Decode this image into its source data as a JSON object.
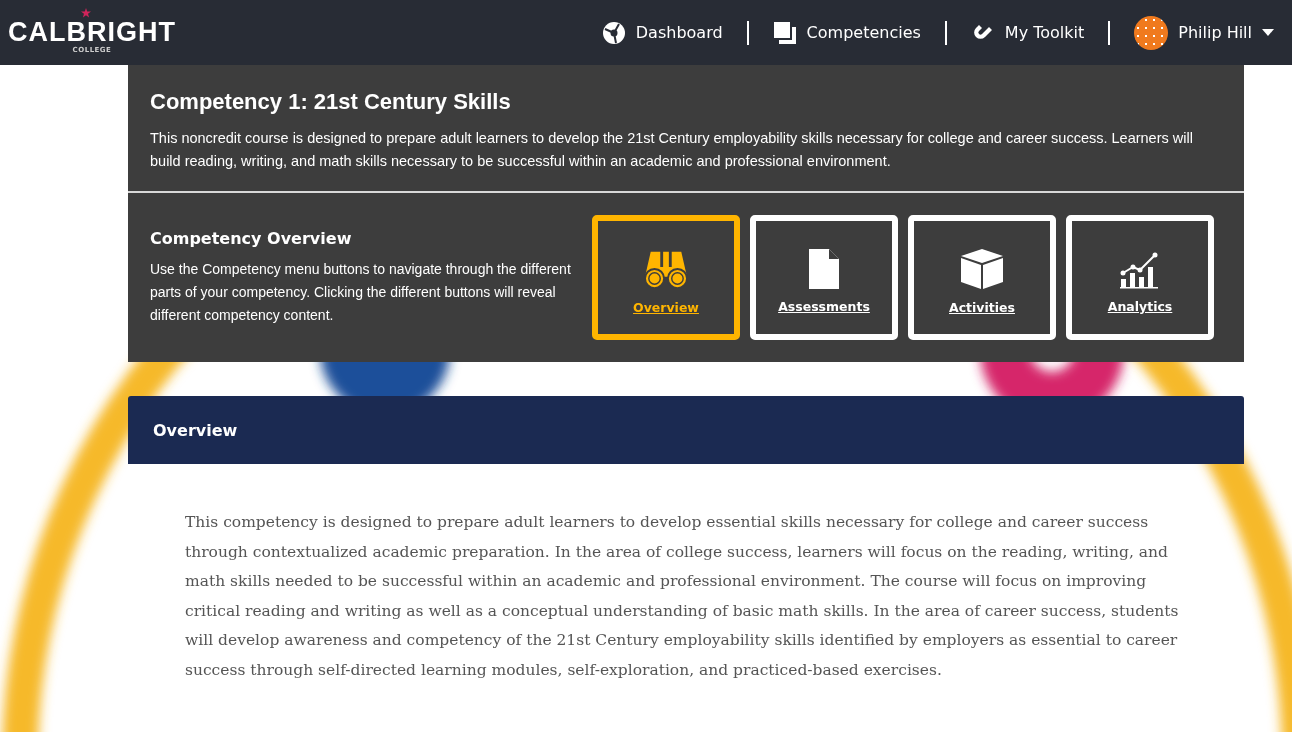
{
  "header": {
    "logo": {
      "word": "CALBRIGHT",
      "sub": "COLLEGE"
    },
    "nav": [
      {
        "label": "Dashboard",
        "kind": "dashboard"
      },
      {
        "label": "Competencies",
        "kind": "competencies"
      },
      {
        "label": "My Toolkit",
        "kind": "toolkit"
      }
    ],
    "user": {
      "name": "Philip Hill"
    }
  },
  "competency": {
    "title": "Competency 1: 21st Century Skills",
    "description": "This noncredit course is designed to prepare adult learners to develop the 21st Century employability skills necessary for college and career success. Learners will build reading, writing, and math skills necessary to be successful within an academic and professional environment."
  },
  "overview_panel": {
    "heading": "Competency Overview",
    "text": "Use the Competency menu buttons to navigate through the different parts of your competency. Clicking the different buttons will reveal different competency content.",
    "buttons": [
      {
        "label": "Overview",
        "kind": "binoculars",
        "selected": true
      },
      {
        "label": "Assessments",
        "kind": "document",
        "selected": false
      },
      {
        "label": "Activities",
        "kind": "cube",
        "selected": false
      },
      {
        "label": "Analytics",
        "kind": "chart",
        "selected": false
      }
    ]
  },
  "section": {
    "title": "Overview",
    "body": "This competency is designed to prepare adult learners to develop essential skills necessary for college and career success through contextualized academic preparation. In the area of college success, learners will focus on the reading, writing, and math skills needed to be successful within an academic and professional environment. The course will focus on improving critical reading and writing as well as a conceptual understanding of basic math skills. In the area of career success, students will develop awareness and competency of the 21st Century employability skills identified by employers as essential to career success through self-directed learning modules, self-exploration, and practiced-based exercises."
  }
}
